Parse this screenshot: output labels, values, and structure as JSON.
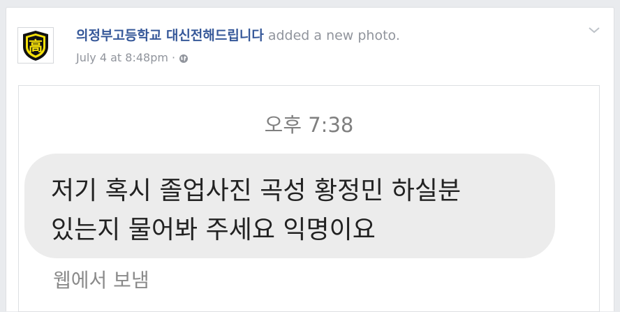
{
  "post": {
    "page_name": "의정부고등학교 대신전해드립니다",
    "action": "added a new photo.",
    "timestamp": "July 4 at 8:48pm",
    "separator": "·",
    "audience_icon": "globe-icon",
    "menu_icon": "chevron-down-icon",
    "avatar_icon": "school-logo-icon",
    "avatar_colors": {
      "shield": "#111111",
      "accent": "#f7e20a"
    },
    "avatar_text": "高"
  },
  "photo": {
    "time": "오후 7:38",
    "message_lines": [
      "저기 혹시 졸업사진 곡성 황정민 하실분",
      "있는지 물어봐 주세요 익명이요"
    ],
    "sent_via": "웹에서 보냄"
  },
  "colors": {
    "page_name": "#365899",
    "meta_text": "#90949c",
    "bubble": "#ececec",
    "background": "#e9ebee"
  }
}
